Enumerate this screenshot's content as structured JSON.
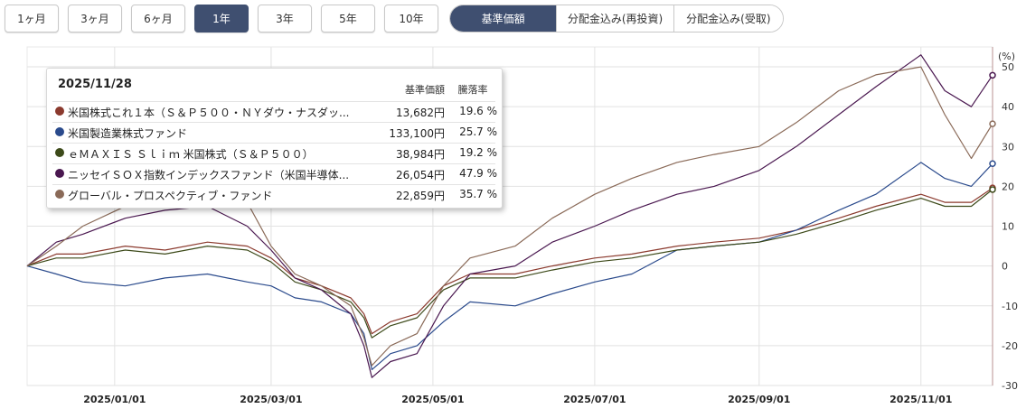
{
  "toolbar": {
    "ranges": [
      "1ヶ月",
      "3ヶ月",
      "6ヶ月",
      "1年",
      "3年",
      "5年",
      "10年"
    ],
    "active_range": "1年",
    "modes": [
      "基準価額",
      "分配金込み(再投資)",
      "分配金込み(受取)"
    ],
    "active_mode": "基準価額"
  },
  "tooltip": {
    "date": "2025/11/28",
    "header_price": "基準価額",
    "header_rate": "騰落率",
    "rows": [
      {
        "name": "米国株式これ１本（Ｓ＆Ｐ５００・ＮＹダウ・ナスダッ...",
        "price": "13,682円",
        "rate": "19.6 %",
        "color": "#8b3a2e"
      },
      {
        "name": "米国製造業株式ファンド",
        "price": "133,100円",
        "rate": "25.7 %",
        "color": "#2a4a8c"
      },
      {
        "name": "ｅＭＡＸＩＳ Ｓｌｉｍ 米国株式（Ｓ＆Ｐ５００）",
        "price": "38,984円",
        "rate": "19.2 %",
        "color": "#3d4a1a"
      },
      {
        "name": "ニッセイＳＯＸ指数インデックスファンド（米国半導体...",
        "price": "26,054円",
        "rate": "47.9 %",
        "color": "#4a1850"
      },
      {
        "name": "グローバル・プロスペクティブ・ファンド",
        "price": "22,859円",
        "rate": "35.7 %",
        "color": "#8a6a58"
      }
    ]
  },
  "chart_data": {
    "type": "line",
    "ylabel": "(%)",
    "ylim": [
      -30,
      55
    ],
    "yticks": [
      50,
      40,
      30,
      20,
      10,
      0,
      -10,
      -20,
      -30
    ],
    "xlim": [
      "2024-11-29",
      "2025-11-28"
    ],
    "xtick_labels": [
      "2025/01/01",
      "2025/03/01",
      "2025/05/01",
      "2025/07/01",
      "2025/09/01",
      "2025/11/01"
    ],
    "xtick_dates": [
      "2025-01-01",
      "2025-03-01",
      "2025-05-01",
      "2025-07-01",
      "2025-09-01",
      "2025-11-01"
    ],
    "grid": true,
    "series": [
      {
        "name": "米国株式これ１本（Ｓ＆Ｐ５００・ＮＹダウ・ナスダッ...",
        "color": "#8b3a2e",
        "points": [
          [
            "2024-11-29",
            0
          ],
          [
            "2024-12-10",
            3
          ],
          [
            "2024-12-20",
            3
          ],
          [
            "2025-01-05",
            5
          ],
          [
            "2025-01-20",
            4
          ],
          [
            "2025-02-05",
            6
          ],
          [
            "2025-02-20",
            5
          ],
          [
            "2025-03-01",
            2
          ],
          [
            "2025-03-10",
            -3
          ],
          [
            "2025-03-20",
            -5
          ],
          [
            "2025-03-31",
            -8
          ],
          [
            "2025-04-05",
            -12
          ],
          [
            "2025-04-08",
            -17
          ],
          [
            "2025-04-15",
            -14
          ],
          [
            "2025-04-25",
            -12
          ],
          [
            "2025-05-05",
            -5
          ],
          [
            "2025-05-15",
            -2
          ],
          [
            "2025-06-01",
            -2
          ],
          [
            "2025-06-15",
            0
          ],
          [
            "2025-07-01",
            2
          ],
          [
            "2025-07-15",
            3
          ],
          [
            "2025-08-01",
            5
          ],
          [
            "2025-08-15",
            6
          ],
          [
            "2025-09-01",
            7
          ],
          [
            "2025-09-15",
            9
          ],
          [
            "2025-10-01",
            12
          ],
          [
            "2025-10-15",
            15
          ],
          [
            "2025-11-01",
            18
          ],
          [
            "2025-11-10",
            16
          ],
          [
            "2025-11-20",
            16
          ],
          [
            "2025-11-28",
            19.6
          ]
        ]
      },
      {
        "name": "米国製造業株式ファンド",
        "color": "#2a4a8c",
        "points": [
          [
            "2024-11-29",
            0
          ],
          [
            "2024-12-10",
            -2
          ],
          [
            "2024-12-20",
            -4
          ],
          [
            "2025-01-05",
            -5
          ],
          [
            "2025-01-20",
            -3
          ],
          [
            "2025-02-05",
            -2
          ],
          [
            "2025-02-20",
            -4
          ],
          [
            "2025-03-01",
            -5
          ],
          [
            "2025-03-10",
            -8
          ],
          [
            "2025-03-20",
            -9
          ],
          [
            "2025-03-31",
            -12
          ],
          [
            "2025-04-05",
            -17
          ],
          [
            "2025-04-08",
            -26
          ],
          [
            "2025-04-15",
            -22
          ],
          [
            "2025-04-25",
            -20
          ],
          [
            "2025-05-05",
            -14
          ],
          [
            "2025-05-15",
            -9
          ],
          [
            "2025-06-01",
            -10
          ],
          [
            "2025-06-15",
            -7
          ],
          [
            "2025-07-01",
            -4
          ],
          [
            "2025-07-15",
            -2
          ],
          [
            "2025-08-01",
            4
          ],
          [
            "2025-08-15",
            5
          ],
          [
            "2025-09-01",
            6
          ],
          [
            "2025-09-15",
            9
          ],
          [
            "2025-10-01",
            14
          ],
          [
            "2025-10-15",
            18
          ],
          [
            "2025-11-01",
            26
          ],
          [
            "2025-11-10",
            22
          ],
          [
            "2025-11-20",
            20
          ],
          [
            "2025-11-28",
            25.7
          ]
        ]
      },
      {
        "name": "ｅＭＡＸＩＳ Ｓｌｉｍ 米国株式（Ｓ＆Ｐ５００）",
        "color": "#3d4a1a",
        "points": [
          [
            "2024-11-29",
            0
          ],
          [
            "2024-12-10",
            2
          ],
          [
            "2024-12-20",
            2
          ],
          [
            "2025-01-05",
            4
          ],
          [
            "2025-01-20",
            3
          ],
          [
            "2025-02-05",
            5
          ],
          [
            "2025-02-20",
            4
          ],
          [
            "2025-03-01",
            1
          ],
          [
            "2025-03-10",
            -4
          ],
          [
            "2025-03-20",
            -6
          ],
          [
            "2025-03-31",
            -9
          ],
          [
            "2025-04-05",
            -13
          ],
          [
            "2025-04-08",
            -18
          ],
          [
            "2025-04-15",
            -15
          ],
          [
            "2025-04-25",
            -13
          ],
          [
            "2025-05-05",
            -6
          ],
          [
            "2025-05-15",
            -3
          ],
          [
            "2025-06-01",
            -3
          ],
          [
            "2025-06-15",
            -1
          ],
          [
            "2025-07-01",
            1
          ],
          [
            "2025-07-15",
            2
          ],
          [
            "2025-08-01",
            4
          ],
          [
            "2025-08-15",
            5
          ],
          [
            "2025-09-01",
            6
          ],
          [
            "2025-09-15",
            8
          ],
          [
            "2025-10-01",
            11
          ],
          [
            "2025-10-15",
            14
          ],
          [
            "2025-11-01",
            17
          ],
          [
            "2025-11-10",
            15
          ],
          [
            "2025-11-20",
            15
          ],
          [
            "2025-11-28",
            19.2
          ]
        ]
      },
      {
        "name": "ニッセイＳＯＸ指数インデックスファンド（米国半導体...",
        "color": "#4a1850",
        "points": [
          [
            "2024-11-29",
            0
          ],
          [
            "2024-12-10",
            6
          ],
          [
            "2024-12-20",
            8
          ],
          [
            "2025-01-05",
            12
          ],
          [
            "2025-01-20",
            14
          ],
          [
            "2025-02-05",
            15
          ],
          [
            "2025-02-20",
            10
          ],
          [
            "2025-03-01",
            4
          ],
          [
            "2025-03-10",
            -3
          ],
          [
            "2025-03-20",
            -6
          ],
          [
            "2025-03-31",
            -12
          ],
          [
            "2025-04-05",
            -20
          ],
          [
            "2025-04-08",
            -28
          ],
          [
            "2025-04-15",
            -24
          ],
          [
            "2025-04-25",
            -22
          ],
          [
            "2025-05-05",
            -10
          ],
          [
            "2025-05-15",
            -2
          ],
          [
            "2025-06-01",
            0
          ],
          [
            "2025-06-15",
            6
          ],
          [
            "2025-07-01",
            10
          ],
          [
            "2025-07-15",
            14
          ],
          [
            "2025-08-01",
            18
          ],
          [
            "2025-08-15",
            20
          ],
          [
            "2025-09-01",
            24
          ],
          [
            "2025-09-15",
            30
          ],
          [
            "2025-10-01",
            38
          ],
          [
            "2025-10-15",
            45
          ],
          [
            "2025-11-01",
            53
          ],
          [
            "2025-11-10",
            44
          ],
          [
            "2025-11-20",
            40
          ],
          [
            "2025-11-28",
            47.9
          ]
        ]
      },
      {
        "name": "グローバル・プロスペクティブ・ファンド",
        "color": "#8a6a58",
        "points": [
          [
            "2024-11-29",
            0
          ],
          [
            "2024-12-10",
            5
          ],
          [
            "2024-12-20",
            10
          ],
          [
            "2025-01-05",
            15
          ],
          [
            "2025-01-20",
            18
          ],
          [
            "2025-02-05",
            24
          ],
          [
            "2025-02-15",
            28
          ],
          [
            "2025-02-20",
            16
          ],
          [
            "2025-03-01",
            5
          ],
          [
            "2025-03-10",
            -2
          ],
          [
            "2025-03-20",
            -5
          ],
          [
            "2025-03-31",
            -10
          ],
          [
            "2025-04-05",
            -18
          ],
          [
            "2025-04-08",
            -25
          ],
          [
            "2025-04-15",
            -20
          ],
          [
            "2025-04-25",
            -17
          ],
          [
            "2025-05-05",
            -5
          ],
          [
            "2025-05-15",
            2
          ],
          [
            "2025-06-01",
            5
          ],
          [
            "2025-06-15",
            12
          ],
          [
            "2025-07-01",
            18
          ],
          [
            "2025-07-15",
            22
          ],
          [
            "2025-08-01",
            26
          ],
          [
            "2025-08-15",
            28
          ],
          [
            "2025-09-01",
            30
          ],
          [
            "2025-09-15",
            36
          ],
          [
            "2025-10-01",
            44
          ],
          [
            "2025-10-15",
            48
          ],
          [
            "2025-11-01",
            50
          ],
          [
            "2025-11-10",
            38
          ],
          [
            "2025-11-20",
            27
          ],
          [
            "2025-11-28",
            35.7
          ]
        ]
      }
    ]
  }
}
